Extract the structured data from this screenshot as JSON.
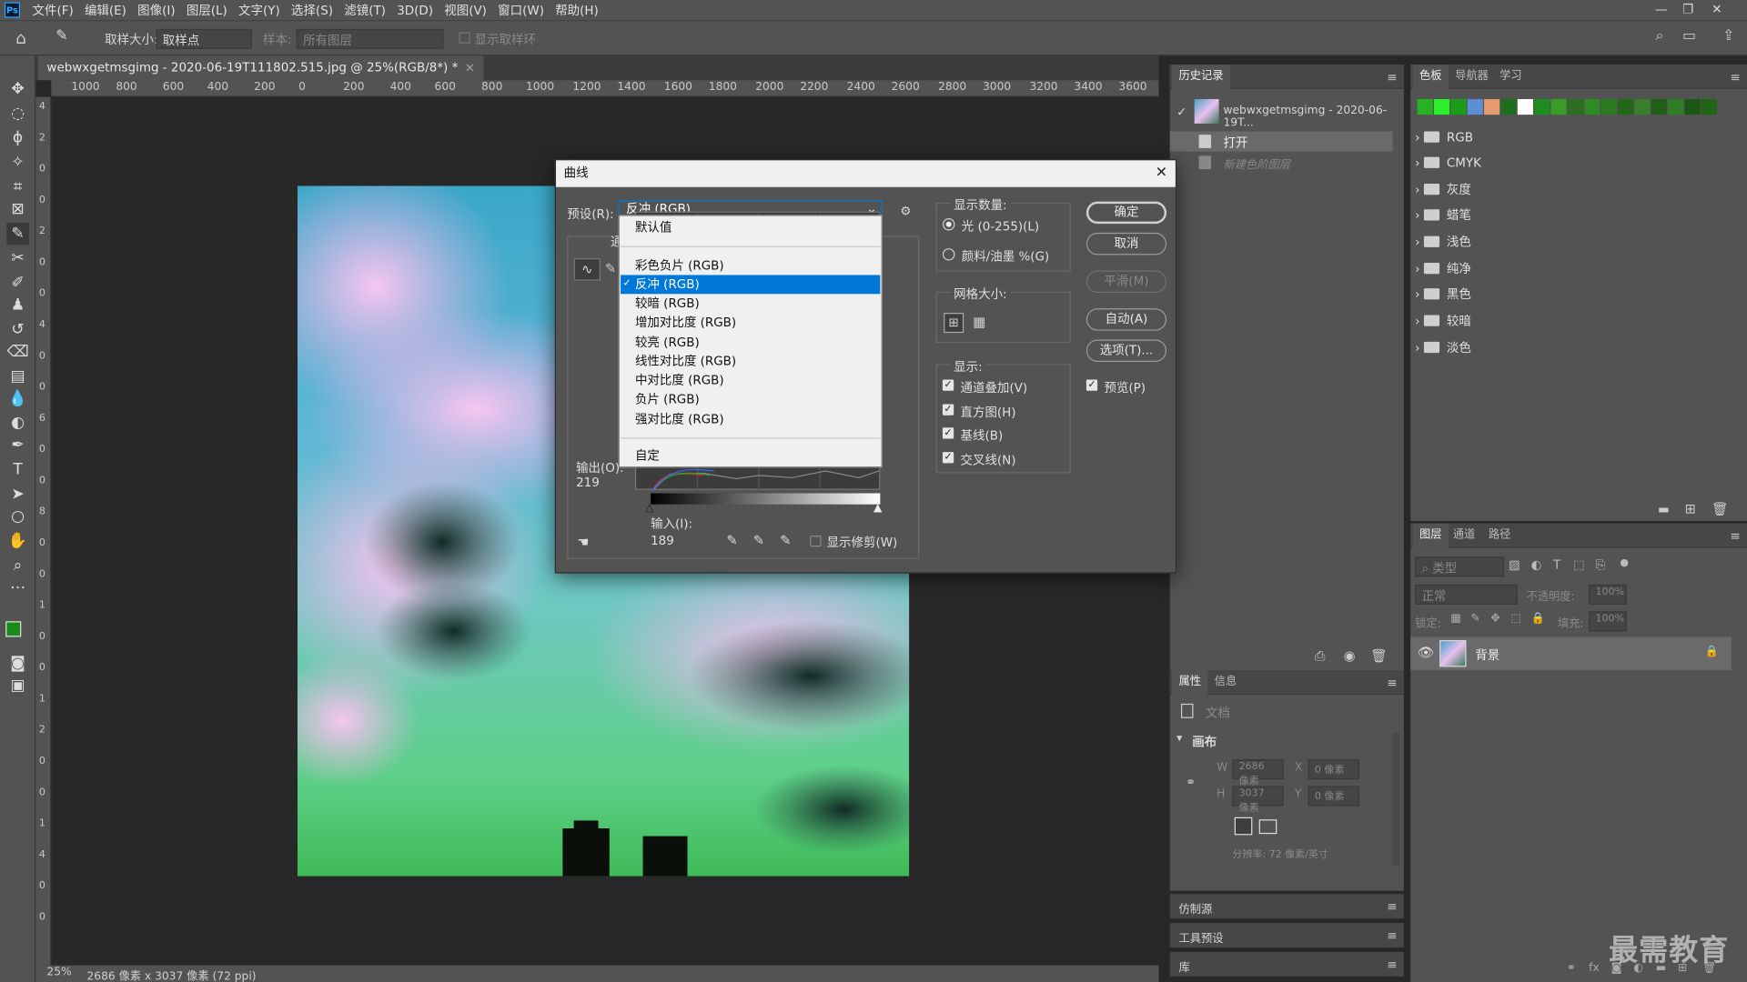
{
  "menubar": {
    "logo": "Ps",
    "items": [
      "文件(F)",
      "编辑(E)",
      "图像(I)",
      "图层(L)",
      "文字(Y)",
      "选择(S)",
      "滤镜(T)",
      "3D(D)",
      "视图(V)",
      "窗口(W)",
      "帮助(H)"
    ]
  },
  "options": {
    "sample_size_label": "取样大小:",
    "sample_size_value": "取样点",
    "sample_label": "样本:",
    "sample_value": "所有图层",
    "show_ring_label": "显示取样环"
  },
  "document": {
    "tab_title": "webwxgetmsgimg - 2020-06-19T111802.515.jpg @ 25%(RGB/8*) *",
    "zoom": "25%",
    "info": "2686 像素 x 3037 像素 (72 ppi)"
  },
  "ruler_h": [
    "1000",
    "800",
    "600",
    "400",
    "200",
    "0",
    "200",
    "400",
    "600",
    "800",
    "1000",
    "1200",
    "1400",
    "1600",
    "1800",
    "2000",
    "2200",
    "2400",
    "2600",
    "2800",
    "3000",
    "3200",
    "3400",
    "3600"
  ],
  "ruler_v": [
    "4",
    "2",
    "0",
    "0",
    "2",
    "0",
    "0",
    "4",
    "0",
    "0",
    "6",
    "0",
    "0",
    "8",
    "0",
    "0",
    "1",
    "0",
    "0",
    "1",
    "2",
    "0",
    "0",
    "1",
    "4",
    "0",
    "0"
  ],
  "history": {
    "tab": "历史记录",
    "snapshot": "webwxgetmsgimg - 2020-06-19T...",
    "items": [
      "打开",
      "新建色阶图层"
    ]
  },
  "swatches": {
    "tabs": [
      "色板",
      "导航器",
      "学习"
    ],
    "colors": [
      "#27b225",
      "#2aef2a",
      "#1d9c1c",
      "#5b8fd4",
      "#e69a6e",
      "#1f6e20",
      "#ffffff",
      "#1e8c1e",
      "#3a9b26",
      "#2b6e1e",
      "#2e8a22",
      "#2b7a20",
      "#216917",
      "#3b7e2b",
      "#1f5f17",
      "#2f7d25",
      "#1a5715",
      "#216416"
    ],
    "groups": [
      "RGB",
      "CMYK",
      "灰度",
      "蜡笔",
      "浅色",
      "纯净",
      "黑色",
      "较暗",
      "淡色"
    ]
  },
  "layers": {
    "tabs": [
      "图层",
      "通道",
      "路径"
    ],
    "search_placeholder": "类型",
    "blend": "正常",
    "opacity_label": "不透明度:",
    "opacity": "100%",
    "lock_label": "锁定:",
    "fill_label": "填充:",
    "fill": "100%",
    "layer_name": "背景"
  },
  "properties": {
    "tabs": [
      "属性",
      "信息"
    ],
    "doc_label": "文档",
    "section": "画布",
    "w_label": "W",
    "w": "2686 像素",
    "h_label": "H",
    "h": "3037 像素",
    "x_label": "X",
    "x": "0 像素",
    "y_label": "Y",
    "y": "0 像素",
    "resolution": "分辨率: 72 像素/英寸"
  },
  "collapsed_panels": [
    "仿制源",
    "工具预设",
    "库"
  ],
  "watermark": "最需教育",
  "curves": {
    "title": "曲线",
    "preset_label": "预设(R):",
    "preset_value": "反冲 (RGB)",
    "channel_stub": "通",
    "presets": [
      "默认值",
      "彩色负片 (RGB)",
      "反冲 (RGB)",
      "较暗 (RGB)",
      "增加对比度 (RGB)",
      "较亮 (RGB)",
      "线性对比度 (RGB)",
      "中对比度 (RGB)",
      "负片 (RGB)",
      "强对比度 (RGB)",
      "自定"
    ],
    "selected_preset": "反冲 (RGB)",
    "output_label": "输出(O):",
    "output_value": "219",
    "input_label": "输入(I):",
    "input_value": "189",
    "show_clipping": "显示修剪(W)",
    "display_amount": {
      "title": "显示数量:",
      "light": "光 (0-255)(L)",
      "pigment": "颜料/油墨 %(G)",
      "selected": "光 (0-255)(L)"
    },
    "grid_size": {
      "title": "网格大小:"
    },
    "show": {
      "title": "显示:",
      "options": [
        {
          "label": "通道叠加(V)",
          "checked": true
        },
        {
          "label": "直方图(H)",
          "checked": true
        },
        {
          "label": "基线(B)",
          "checked": true
        },
        {
          "label": "交叉线(N)",
          "checked": true
        }
      ]
    },
    "buttons": {
      "ok": "确定",
      "cancel": "取消",
      "smooth": "平滑(M)",
      "auto": "自动(A)",
      "options": "选项(T)..."
    },
    "preview": {
      "label": "预览(P)",
      "checked": true
    }
  }
}
